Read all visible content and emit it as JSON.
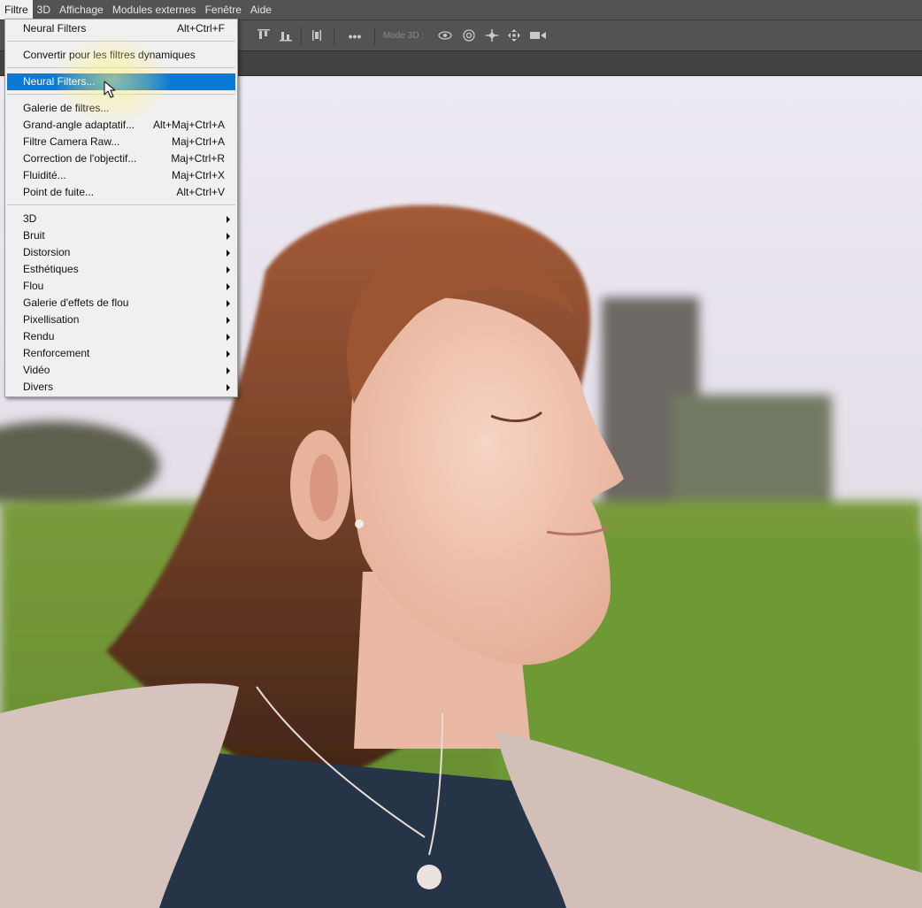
{
  "menubar": {
    "items": [
      "Filtre",
      "3D",
      "Affichage",
      "Modules externes",
      "Fenêtre",
      "Aide"
    ]
  },
  "optbar": {
    "more_label": "•••",
    "mode3d_label": "Mode 3D :",
    "icons": [
      "align-top-icon",
      "align-vertical-center-icon",
      "align-bottom-icon",
      "distribute-icon",
      "more-options-icon",
      "orbit-3d-icon",
      "roll-3d-icon",
      "pan-3d-icon",
      "slide-3d-icon",
      "scale-3d-icon"
    ]
  },
  "menu": {
    "items": [
      {
        "label": "Neural Filters",
        "shortcut": "Alt+Ctrl+F"
      },
      {
        "label": "Convertir pour les filtres dynamiques",
        "shortcut": ""
      },
      {
        "label": "Neural Filters...",
        "shortcut": "",
        "highlighted": true
      },
      {
        "label": "Galerie de filtres...",
        "shortcut": ""
      },
      {
        "label": "Grand-angle adaptatif...",
        "shortcut": "Alt+Maj+Ctrl+A"
      },
      {
        "label": "Filtre Camera Raw...",
        "shortcut": "Maj+Ctrl+A"
      },
      {
        "label": "Correction de l'objectif...",
        "shortcut": "Maj+Ctrl+R"
      },
      {
        "label": "Fluidité...",
        "shortcut": "Maj+Ctrl+X"
      },
      {
        "label": "Point de fuite...",
        "shortcut": "Alt+Ctrl+V"
      }
    ],
    "submenus": [
      "3D",
      "Bruit",
      "Distorsion",
      "Esthétiques",
      "Flou",
      "Galerie d'effets de flou",
      "Pixellisation",
      "Rendu",
      "Renforcement",
      "Vidéo",
      "Divers"
    ]
  },
  "colors": {
    "highlight": "#0a7ad6",
    "menu_bg": "#f0f0f0",
    "ui_bg": "#535353"
  }
}
